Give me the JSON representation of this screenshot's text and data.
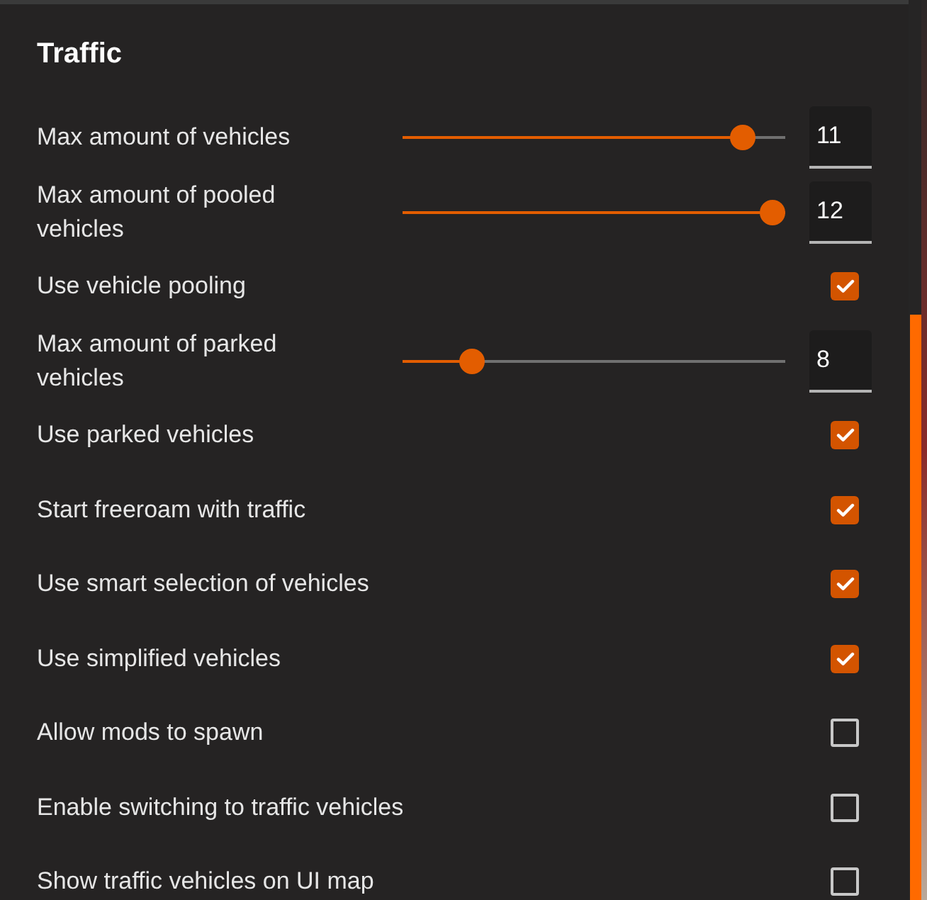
{
  "panel": {
    "title": "Traffic",
    "settings": [
      {
        "kind": "slider",
        "label": "Max amount of vehicles",
        "level": 0.917,
        "value": "11"
      },
      {
        "kind": "slider",
        "label": "Max amount of pooled vehicles",
        "level": 1,
        "value": "12"
      },
      {
        "kind": "checkbox",
        "label": "Use vehicle pooling",
        "checked": true
      },
      {
        "kind": "slider",
        "label": "Max amount of parked vehicles",
        "level": 0.16,
        "value": "8"
      },
      {
        "kind": "checkbox",
        "label": "Use parked vehicles",
        "checked": true
      },
      {
        "kind": "checkbox",
        "label": "Start freeroam with traffic",
        "checked": true
      },
      {
        "kind": "checkbox",
        "label": "Use smart selection of vehicles",
        "checked": true
      },
      {
        "kind": "checkbox",
        "label": "Use simplified vehicles",
        "checked": true
      },
      {
        "kind": "checkbox",
        "label": "Allow mods to spawn",
        "checked": false
      },
      {
        "kind": "checkbox",
        "label": "Enable switching to traffic vehicles",
        "checked": false
      },
      {
        "kind": "checkbox",
        "label": "Show traffic vehicles on UI map",
        "checked": false
      }
    ]
  }
}
